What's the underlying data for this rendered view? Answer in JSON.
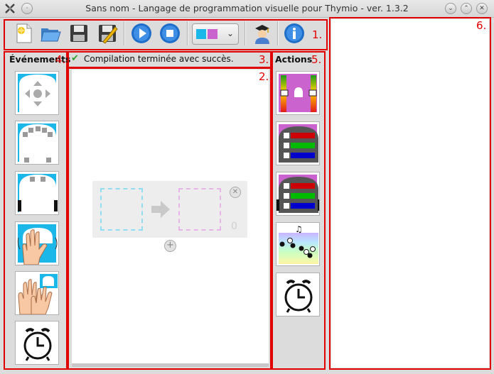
{
  "window": {
    "title": "Sans nom - Langage de programmation visuelle pour Thymio - ver. 1.3.2"
  },
  "toolbar": {
    "buttons": [
      "new-file-icon",
      "open-folder-icon",
      "save-icon",
      "save-as-icon",
      "run-icon",
      "stop-icon",
      "color-scheme-icon",
      "advanced-mode-icon",
      "help-icon"
    ]
  },
  "annotations": {
    "n1": "1.",
    "n2": "2.",
    "n3": "3.",
    "n4": "4.",
    "n5": "5.",
    "n6": "6."
  },
  "left_panel": {
    "label": "Événements"
  },
  "right_panel": {
    "label": "Actions"
  },
  "status": {
    "text": "Compilation terminée avec succès."
  },
  "scene": {
    "pair_number": "0"
  },
  "colors": {
    "event_blue": "#1bb7e8",
    "action_pink": "#cb63cf",
    "annotation_red": "#e10000"
  }
}
